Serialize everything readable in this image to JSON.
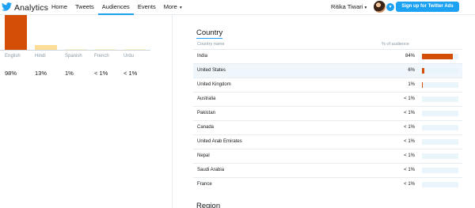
{
  "header": {
    "brand": "Analytics",
    "nav": [
      {
        "label": "Home"
      },
      {
        "label": "Tweets"
      },
      {
        "label": "Audiences",
        "active": true
      },
      {
        "label": "Events"
      },
      {
        "label": "More",
        "caret": "▾"
      }
    ],
    "user_name": "Ritika Tiwari",
    "user_caret": "▾",
    "chevron": "▾",
    "signup_label": "Sign up for Twitter Ads",
    "accent_color": "#1da1f2"
  },
  "languages": {
    "bar_colors": {
      "primary": "#d44e08",
      "secondary": "#ffdd99",
      "tertiary": "#fff0cc"
    },
    "items": [
      {
        "name": "English",
        "pct_label": "98%",
        "value": 98
      },
      {
        "name": "Hindi",
        "pct_label": "13%",
        "value": 13
      },
      {
        "name": "Spanish",
        "pct_label": "1%",
        "value": 1
      },
      {
        "name": "French",
        "pct_label": "< 1%",
        "value": 0.5
      },
      {
        "name": "Urdu",
        "pct_label": "< 1%",
        "value": 0.5
      }
    ]
  },
  "country": {
    "title": "Country",
    "col_name": "Country name",
    "col_pct": "% of audience",
    "bar_color": "#d44e08",
    "track_color": "#eaf4fb",
    "rows": [
      {
        "name": "India",
        "pct_label": "84%",
        "value": 84
      },
      {
        "name": "United States",
        "pct_label": "6%",
        "value": 6,
        "highlight": true
      },
      {
        "name": "United Kingdom",
        "pct_label": "1%",
        "value": 1
      },
      {
        "name": "Australia",
        "pct_label": "< 1%",
        "value": 0
      },
      {
        "name": "Pakistan",
        "pct_label": "< 1%",
        "value": 0
      },
      {
        "name": "Canada",
        "pct_label": "< 1%",
        "value": 0
      },
      {
        "name": "United Arab Emirates",
        "pct_label": "< 1%",
        "value": 0
      },
      {
        "name": "Nepal",
        "pct_label": "< 1%",
        "value": 0
      },
      {
        "name": "Saudi Arabia",
        "pct_label": "< 1%",
        "value": 0
      },
      {
        "name": "France",
        "pct_label": "< 1%",
        "value": 0
      }
    ]
  },
  "region": {
    "title": "Region"
  }
}
